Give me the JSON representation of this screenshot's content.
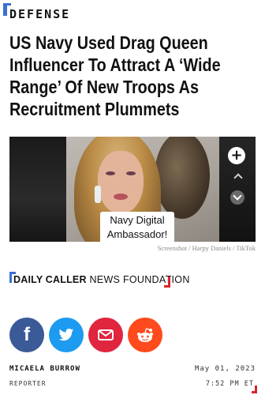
{
  "section": {
    "label": "DEFENSE"
  },
  "article": {
    "headline": "US Navy Used Drag Queen Influencer To Attract A ‘Wide Range’ Of New Troops As Recruitment Plummets"
  },
  "media": {
    "caption_line1": "Navy Digital",
    "caption_line2": "Ambassador!",
    "plus_icon_glyph": "+",
    "credit": "Screenshot / Harpy Daniels / TikTok"
  },
  "brand": {
    "bold": "DAILY CALLER",
    "light": " NEWS FOUNDATION",
    "colors": {
      "blue": "#3b6fd1",
      "red": "#d9252a"
    }
  },
  "share": {
    "facebook_icon": "f",
    "twitter_icon": "🐦",
    "email_icon": "✉",
    "reddit_icon": "👽",
    "colors": {
      "facebook": "#3a5a98",
      "twitter": "#1d9bf0",
      "email": "#e0253f",
      "reddit": "#ff4a1d"
    }
  },
  "byline": {
    "author": "MICAELA BURROW",
    "role": "REPORTER",
    "date": "May 01, 2023",
    "time": "7:52 PM ET"
  }
}
